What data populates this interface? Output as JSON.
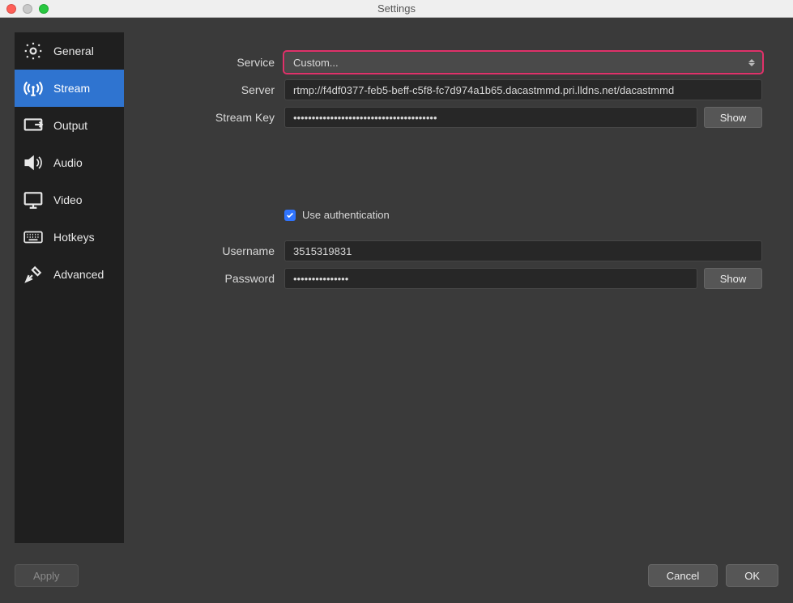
{
  "window": {
    "title": "Settings"
  },
  "sidebar": {
    "items": [
      {
        "label": "General"
      },
      {
        "label": "Stream"
      },
      {
        "label": "Output"
      },
      {
        "label": "Audio"
      },
      {
        "label": "Video"
      },
      {
        "label": "Hotkeys"
      },
      {
        "label": "Advanced"
      }
    ]
  },
  "form": {
    "service_label": "Service",
    "service_value": "Custom...",
    "server_label": "Server",
    "server_value": "rtmp://f4df0377-feb5-beff-c5f8-fc7d974a1b65.dacastmmd.pri.lldns.net/dacastmmd",
    "streamkey_label": "Stream Key",
    "streamkey_value": "•••••••••••••••••••••••••••••••••••••••",
    "show_label": "Show",
    "auth_checkbox_label": "Use authentication",
    "auth_checked": true,
    "username_label": "Username",
    "username_value": "3515319831",
    "password_label": "Password",
    "password_value": "•••••••••••••••"
  },
  "footer": {
    "apply": "Apply",
    "cancel": "Cancel",
    "ok": "OK"
  }
}
